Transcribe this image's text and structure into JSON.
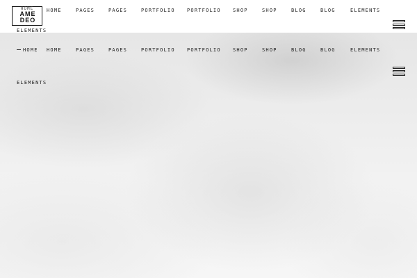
{
  "header": {
    "logo": {
      "home_label": "HOME",
      "line1": "AME",
      "line2": "DEO"
    },
    "below_logo_label": "ELEMENTS",
    "nav": [
      "HOME",
      "PAGES",
      "PAGES",
      "PORTFOLIO",
      "PORTFOLIO",
      "SHOP",
      "SHOP",
      "BLOG",
      "BLOG",
      "ELEMENTS"
    ]
  },
  "sticky_header": {
    "first_label": "HOME",
    "nav": [
      "HOME",
      "PAGES",
      "PAGES",
      "PORTFOLIO",
      "PORTFOLIO",
      "SHOP",
      "SHOP",
      "BLOG",
      "BLOG",
      "ELEMENTS"
    ],
    "below_label": "ELEMENTS"
  },
  "icons": {
    "menu": "hamburger-menu-icon"
  }
}
